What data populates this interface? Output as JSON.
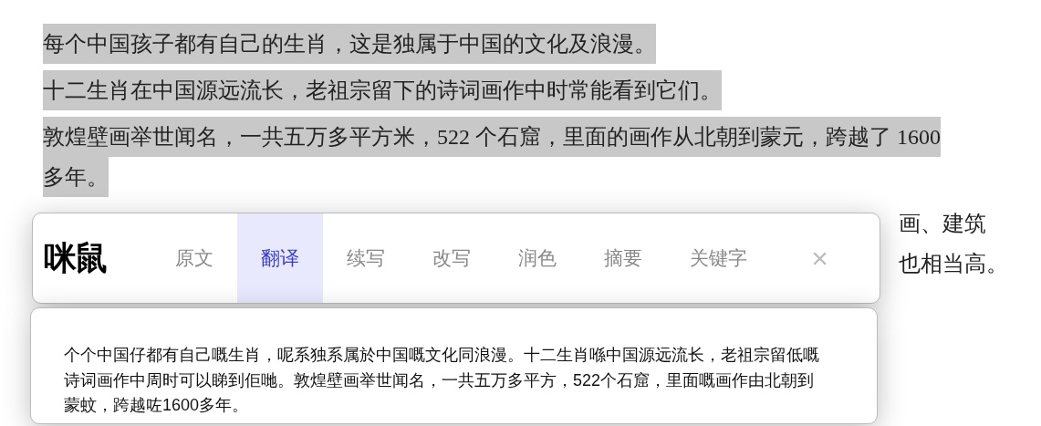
{
  "document": {
    "paragraphs": [
      {
        "lines": [
          "每个中国孩子都有自己的生肖，这是独属于中国的文化及浪漫。"
        ],
        "selected": true
      },
      {
        "lines": [
          "十二生肖在中国源远流长，老祖宗留下的诗词画作中时常能看到它们。"
        ],
        "selected": true
      },
      {
        "lines": [
          "敦煌壁画举世闻名，一共五万多平方米，522 个石窟，里面的画作从北朝到蒙元，跨越了 1600",
          "多年。"
        ],
        "selected": true
      }
    ],
    "covered_fragments": [
      "画、建筑",
      "也相当高。"
    ]
  },
  "popup": {
    "logo": "咪鼠",
    "tabs": [
      {
        "label": "原文",
        "selected": false
      },
      {
        "label": "翻译",
        "selected": true
      },
      {
        "label": "续写",
        "selected": false
      },
      {
        "label": "改写",
        "selected": false
      },
      {
        "label": "润色",
        "selected": false
      },
      {
        "label": "摘要",
        "selected": false
      },
      {
        "label": "关键字",
        "selected": false
      }
    ],
    "close": "×",
    "result": "个个中国仔都有自己嘅生肖，呢系独系属於中国嘅文化同浪漫。十二生肖喺中国源远流长，老祖宗留低嘅诗词画作中周时可以睇到佢哋。敦煌壁画举世闻名，一共五万多平方，522个石窟，里面嘅画作由北朝到蒙蚊，跨越咗1600多年。"
  }
}
